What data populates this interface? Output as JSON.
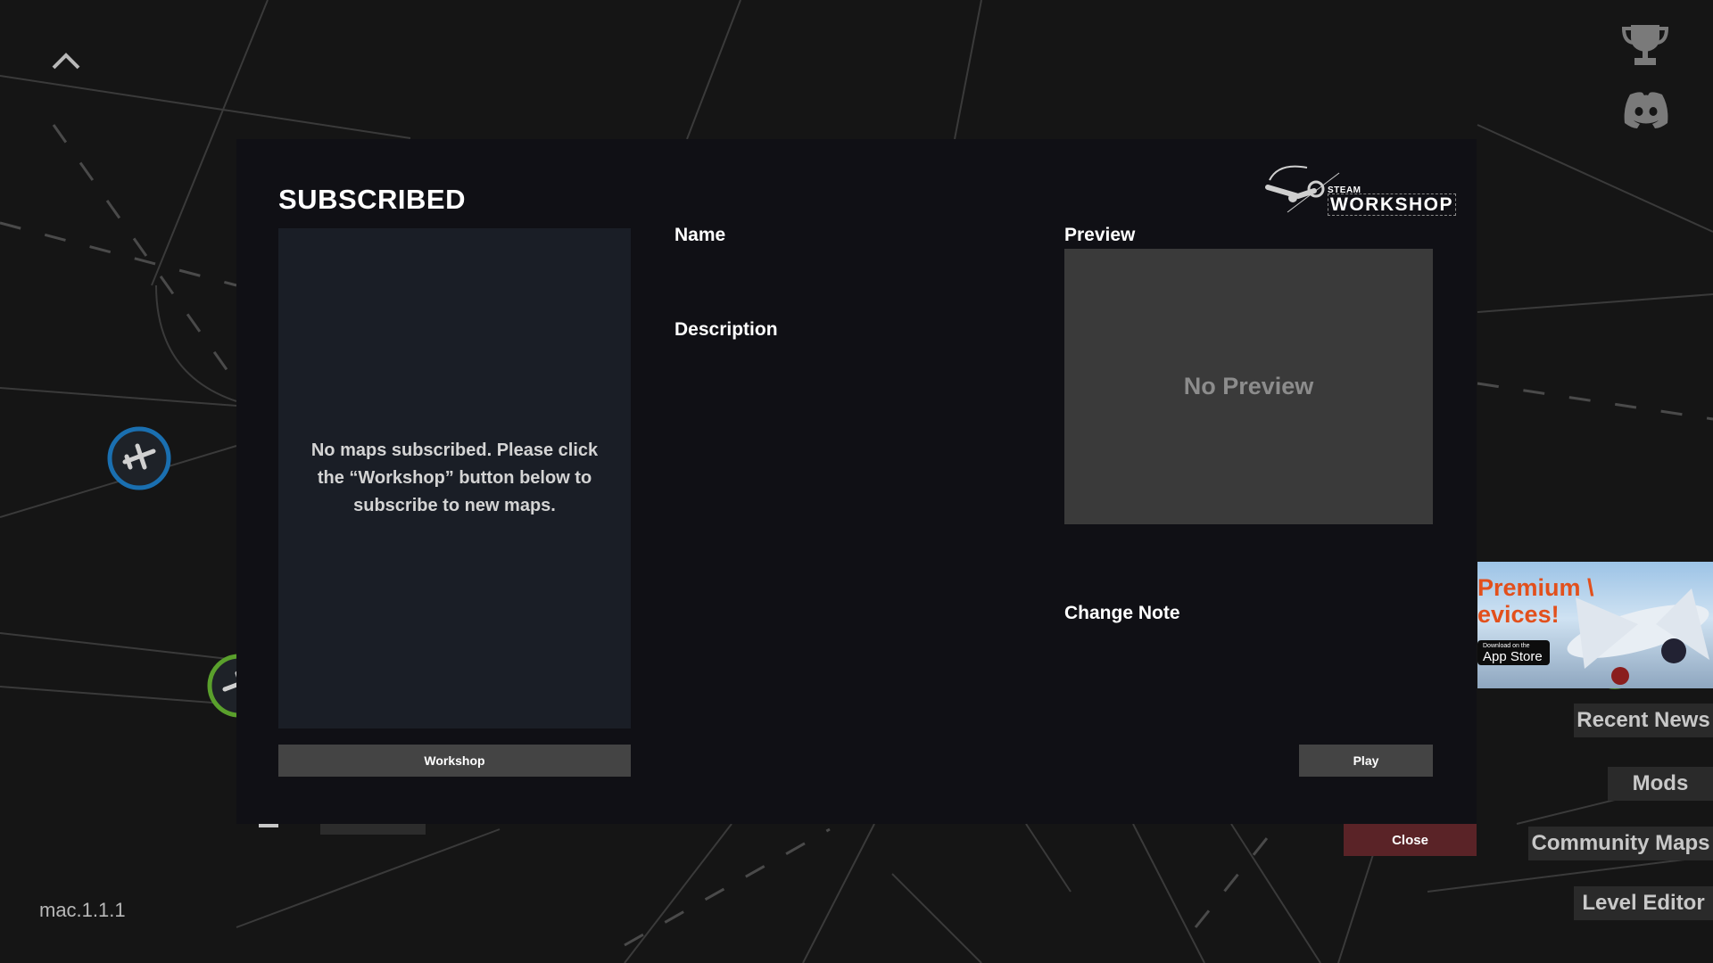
{
  "background": {
    "color": "#151515",
    "line_color": "#3c3c3c"
  },
  "colors": {
    "dialog_bg": "#101015",
    "panel_bg": "#1a1e26",
    "button_bg": "#444444",
    "close_bg": "#5a2327",
    "airport_blue": "#1a6fb0",
    "airport_green": "#5aa02c"
  },
  "icons": {
    "up": "chevron-up-icon",
    "trophy": "trophy-icon",
    "discord": "discord-icon",
    "airport": "airplane-icon"
  },
  "version": "mac.1.1.1",
  "side_menu": {
    "recent_news": "Recent News",
    "mods": "Mods",
    "community_maps": "Community Maps",
    "level_editor": "Level Editor"
  },
  "ad": {
    "headline_1": "Premium \\",
    "headline_2": "evices!",
    "store_small": "Download on the",
    "store_name": "App Store"
  },
  "dialog": {
    "title": "SUBSCRIBED",
    "logo_small": "STEAM",
    "logo_big": "WORKSHOP",
    "empty_message": "No maps subscribed. Please click the “Workshop” button below to subscribe to new maps.",
    "workshop_button": "Workshop",
    "name_label": "Name",
    "description_label": "Description",
    "preview_label": "Preview",
    "no_preview": "No Preview",
    "change_note_label": "Change Note",
    "play_button": "Play"
  },
  "close_button": "Close"
}
